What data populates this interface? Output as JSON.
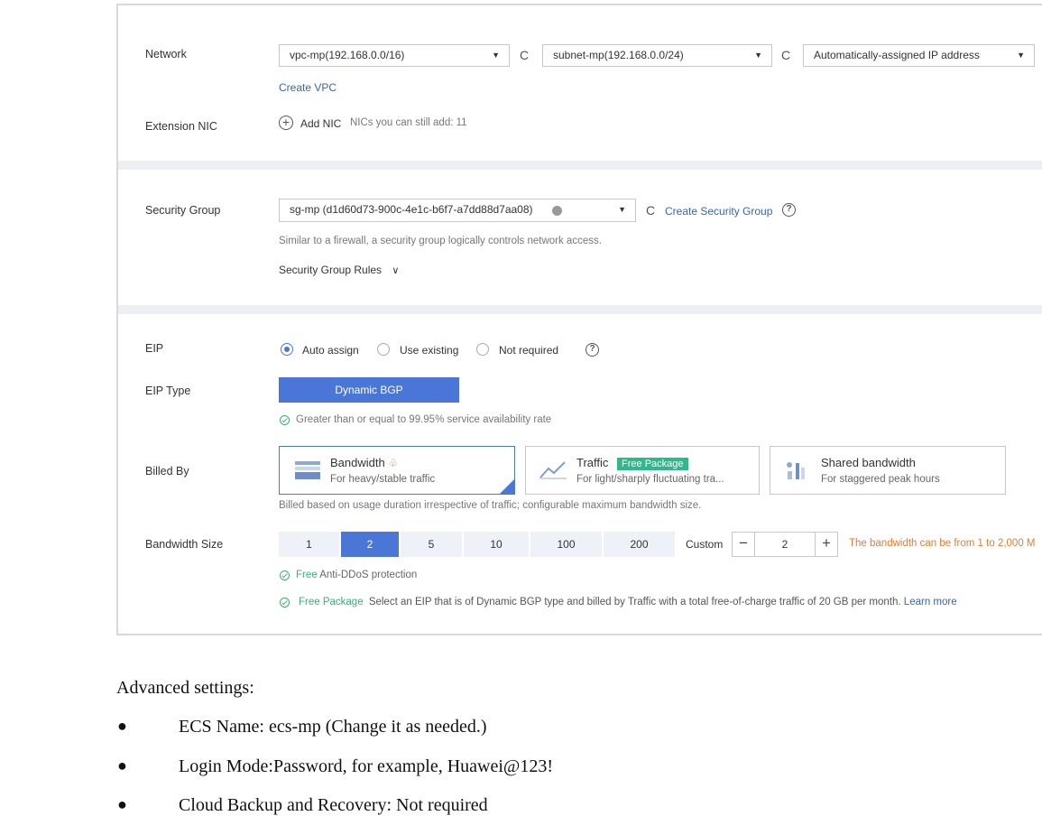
{
  "network": {
    "label": "Network",
    "vpc_value": "vpc-mp(192.168.0.0/16)",
    "subnet_value": "subnet-mp(192.168.0.0/24)",
    "ip_value": "Automatically-assigned IP address",
    "create_vpc": "Create VPC"
  },
  "extension_nic": {
    "label": "Extension NIC",
    "add_nic": "Add NIC",
    "remaining": "NICs you can still add: 11"
  },
  "security_group": {
    "label": "Security Group",
    "value": "sg-mp (d1d60d73-900c-4e1c-b6f7-a7dd88d7aa08)",
    "create_link": "Create Security Group",
    "description": "Similar to a firewall, a security group logically controls network access.",
    "rules_toggle": "Security Group Rules"
  },
  "eip": {
    "label": "EIP",
    "options": [
      "Auto assign",
      "Use existing",
      "Not required"
    ],
    "selected": "Auto assign",
    "type_label": "EIP Type",
    "type_button": "Dynamic BGP",
    "availability": "Greater than or equal to 99.95% service availability rate"
  },
  "billed_by": {
    "label": "Billed By",
    "cards": [
      {
        "title": "Bandwidth",
        "subtitle": "For heavy/stable traffic",
        "selected": true
      },
      {
        "title": "Traffic",
        "badge": "Free Package",
        "subtitle": "For light/sharply fluctuating tra...",
        "selected": false
      },
      {
        "title": "Shared bandwidth",
        "subtitle": "For staggered peak hours",
        "selected": false
      }
    ],
    "note": "Billed based on usage duration irrespective of traffic; configurable maximum bandwidth size."
  },
  "bandwidth_size": {
    "label": "Bandwidth Size",
    "options": [
      "1",
      "2",
      "5",
      "10",
      "100",
      "200"
    ],
    "selected": "2",
    "custom_label": "Custom",
    "custom_value": "2",
    "range_note": "The bandwidth can be from 1 to 2,000 M",
    "anti_ddos_free": "Free",
    "anti_ddos_text": "Anti-DDoS protection",
    "free_package_label": "Free Package",
    "free_package_text": "Select an EIP that is of Dynamic BGP type and billed by Traffic with a total free-of-charge traffic of 20 GB per month.",
    "learn_more": "Learn more"
  },
  "document": {
    "heading": "Advanced settings:",
    "bullets": [
      "ECS Name: ecs-mp (Change it as needed.)",
      "Login Mode:Password, for example, Huawei@123!",
      "Cloud Backup and Recovery: Not required"
    ]
  },
  "colors": {
    "accent": "#4a76d8",
    "link": "#3a63b8",
    "success": "#3cae76",
    "warning": "#e9792d",
    "badge": "#2fb98a"
  }
}
